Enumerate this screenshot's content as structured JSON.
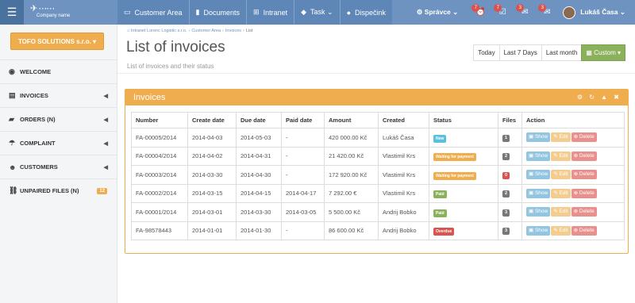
{
  "topbar": {
    "logo_text": "Company name",
    "nav": [
      {
        "icon": "desktop-icon",
        "glyph": "▭",
        "label": "Customer Area"
      },
      {
        "icon": "documents-icon",
        "glyph": "▮",
        "label": "Documents"
      },
      {
        "icon": "sitemap-icon",
        "glyph": "⊞",
        "label": "Intranet"
      },
      {
        "icon": "tag-icon",
        "glyph": "◆",
        "label": "Task ⌄"
      },
      {
        "icon": "map-marker-icon",
        "glyph": "●",
        "label": "Dispečink"
      }
    ],
    "admin_label": "⚙ Správce ⌄",
    "notifications": [
      {
        "icon": "alarm-icon",
        "glyph": "⏰",
        "count": "7"
      },
      {
        "icon": "tasks-icon",
        "glyph": "☑",
        "count": "7"
      },
      {
        "icon": "comments-icon",
        "glyph": "✉",
        "count": "3"
      },
      {
        "icon": "messages-icon",
        "glyph": "✉",
        "count": "3"
      }
    ],
    "user_name": "Lukáš Časa ⌄"
  },
  "sidebar": {
    "company": "TOFO SOLUTIONS s.r.o. ▾",
    "items": [
      {
        "icon": "dashboard-icon",
        "glyph": "◉",
        "label": "WELCOME",
        "arrow": ""
      },
      {
        "icon": "print-icon",
        "glyph": "▤",
        "label": "INVOICES",
        "arrow": "◀"
      },
      {
        "icon": "truck-icon",
        "glyph": "▰",
        "label": "ORDERS (N)",
        "arrow": "◀"
      },
      {
        "icon": "umbrella-icon",
        "glyph": "☂",
        "label": "COMPLAINT",
        "arrow": "◀"
      },
      {
        "icon": "users-icon",
        "glyph": "☻",
        "label": "CUSTOMERS",
        "arrow": "◀"
      },
      {
        "icon": "chain-broken-icon",
        "glyph": "⛓",
        "label": "UNPAIRED FILES (N)",
        "arrow": ""
      }
    ],
    "unpaired_count": "12"
  },
  "breadcrumb": [
    "Intranet Lorenc Logistic s.r.o.",
    "Customer Area",
    "Invoices",
    "List"
  ],
  "page": {
    "title": "List of invoices",
    "subtitle": "List of invoices and their status"
  },
  "date_filters": [
    "Today",
    "Last 7 Days",
    "Last month",
    "▦ Custom ▾"
  ],
  "panel": {
    "title": "Invoices",
    "tool_icons": "⚙ ↻ ▲ ✖"
  },
  "table": {
    "headers": [
      "Number",
      "Create date",
      "Due date",
      "Paid date",
      "Amount",
      "Created",
      "Status",
      "Files",
      "Action"
    ],
    "actions": {
      "show": "▣ Show",
      "edit": "✎ Edit",
      "delete": "⊗ Delete"
    },
    "rows": [
      {
        "number": "FA-00005/2014",
        "create": "2014-04-03",
        "due": "2014-05-03",
        "paid": "-",
        "amount": "420 000.00 Kč",
        "created": "Lukáš Časa",
        "status": "New",
        "status_color": "#5bc0de",
        "files": "1",
        "files_color": "#777777"
      },
      {
        "number": "FA-00004/2014",
        "create": "2014-04-02",
        "due": "2014-04-31",
        "paid": "-",
        "amount": "21 420.00 Kč",
        "created": "Vlastimil Krs",
        "status": "Waiting for payment",
        "status_color": "#f0ad4e",
        "files": "2",
        "files_color": "#777777"
      },
      {
        "number": "FA-00003/2014",
        "create": "2014-03-30",
        "due": "2014-04-30",
        "paid": "-",
        "amount": "172 920.00 Kč",
        "created": "Vlastimil Krs",
        "status": "Waiting for payment",
        "status_color": "#f0ad4e",
        "files": "0",
        "files_color": "#d9534f"
      },
      {
        "number": "FA-00002/2014",
        "create": "2014-03-15",
        "due": "2014-04-15",
        "paid": "2014-04-17",
        "amount": "7 292.00 €",
        "created": "Vlastimil Krs",
        "status": "Paid",
        "status_color": "#8bb15d",
        "files": "2",
        "files_color": "#777777"
      },
      {
        "number": "FA-00001/2014",
        "create": "2014-03-01",
        "due": "2014-03-30",
        "paid": "2014-03-05",
        "amount": "5 500.00 Kč",
        "created": "Andrij Bobko",
        "status": "Paid",
        "status_color": "#8bb15d",
        "files": "3",
        "files_color": "#777777"
      },
      {
        "number": "FA-98578443",
        "create": "2014-01-01",
        "due": "2014-01-30",
        "paid": "-",
        "amount": "86 600.00 Kč",
        "created": "Andrij Bobko",
        "status": "Overdue",
        "status_color": "#d9534f",
        "files": "3",
        "files_color": "#777777"
      }
    ]
  },
  "colors": {
    "topbar": "#6e93c0",
    "accent": "#f0ad4e",
    "custom_btn": "#8bb15d"
  }
}
